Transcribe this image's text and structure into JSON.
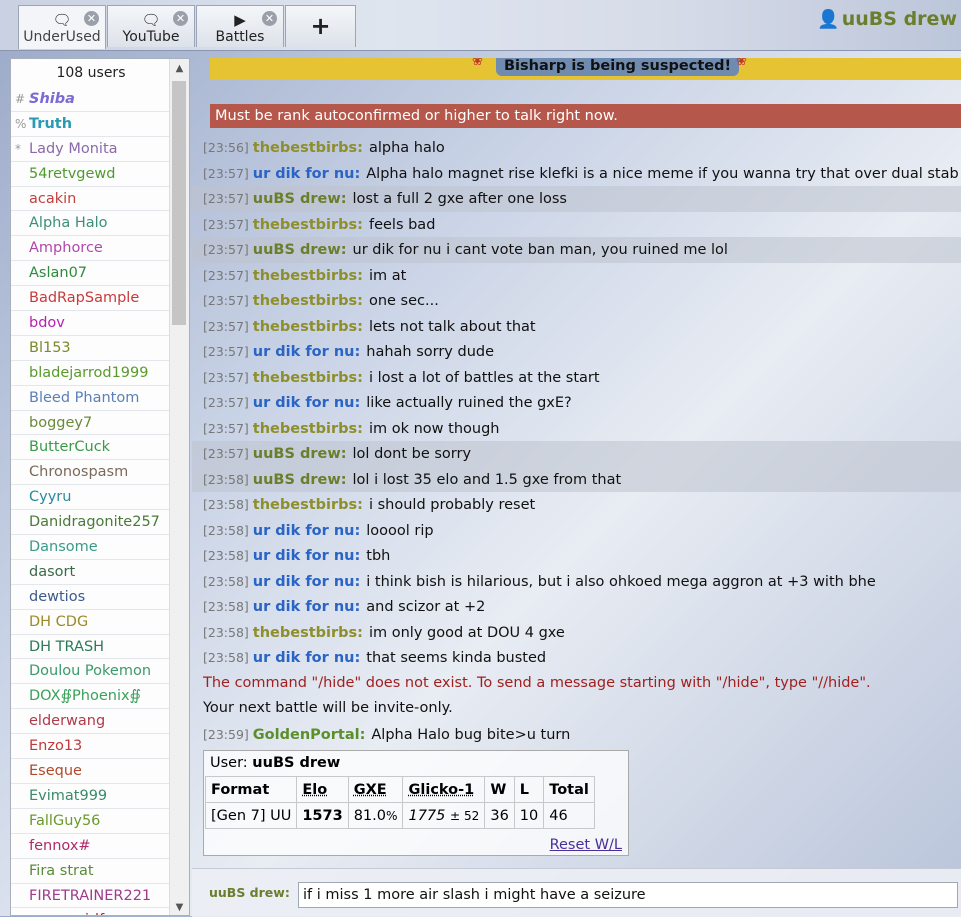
{
  "tabs": [
    {
      "label": "UnderUsed",
      "icon": "chat-bubble-icon",
      "active": true
    },
    {
      "label": "YouTube",
      "icon": "chat-bubble-icon",
      "active": false
    },
    {
      "label": "Battles",
      "icon": "battle-play-icon",
      "active": false
    }
  ],
  "new_tab_label": "+",
  "current_user": "uuBS drew",
  "userlist": {
    "count_label": "108 users",
    "users": [
      {
        "rank": "#",
        "name": "Shiba",
        "color": "#7b6bd4",
        "bold": true,
        "italic": true
      },
      {
        "rank": "%",
        "name": "Truth",
        "color": "#2a9bb0",
        "bold": true,
        "italic": false
      },
      {
        "rank": "*",
        "name": "Lady Monita",
        "color": "#8a6aa8",
        "bold": false,
        "italic": false
      },
      {
        "rank": "",
        "name": "54retvgewd",
        "color": "#4f9a2e",
        "bold": false,
        "italic": false
      },
      {
        "rank": "",
        "name": "acakin",
        "color": "#c2403e",
        "bold": false,
        "italic": false
      },
      {
        "rank": "",
        "name": "Alpha Halo",
        "color": "#3c8f7a",
        "bold": false,
        "italic": false
      },
      {
        "rank": "",
        "name": "Amphorce",
        "color": "#b048a8",
        "bold": false,
        "italic": false
      },
      {
        "rank": "",
        "name": "Aslan07",
        "color": "#2d8a3e",
        "bold": false,
        "italic": false
      },
      {
        "rank": "",
        "name": "BadRapSample",
        "color": "#c83a3a",
        "bold": false,
        "italic": false
      },
      {
        "rank": "",
        "name": "bdov",
        "color": "#b520b0",
        "bold": false,
        "italic": false
      },
      {
        "rank": "",
        "name": "Bl153",
        "color": "#7a8a2a",
        "bold": false,
        "italic": false
      },
      {
        "rank": "",
        "name": "bladejarrod1999",
        "color": "#5a9a2a",
        "bold": false,
        "italic": false
      },
      {
        "rank": "",
        "name": "Bleed Phantom",
        "color": "#5a80b8",
        "bold": false,
        "italic": false
      },
      {
        "rank": "",
        "name": "boggey7",
        "color": "#6a8a3a",
        "bold": false,
        "italic": false
      },
      {
        "rank": "",
        "name": "ButterCuck",
        "color": "#3a9a4a",
        "bold": false,
        "italic": false
      },
      {
        "rank": "",
        "name": "Chronospasm",
        "color": "#7a6a5a",
        "bold": false,
        "italic": false
      },
      {
        "rank": "",
        "name": "Cyyru",
        "color": "#2a8aa0",
        "bold": false,
        "italic": false
      },
      {
        "rank": "",
        "name": "Danidragonite257",
        "color": "#4a7a3a",
        "bold": false,
        "italic": false
      },
      {
        "rank": "",
        "name": "Dansome",
        "color": "#3a9a8a",
        "bold": false,
        "italic": false
      },
      {
        "rank": "",
        "name": "dasort",
        "color": "#3a6a4a",
        "bold": false,
        "italic": false
      },
      {
        "rank": "",
        "name": "dewtios",
        "color": "#3a5a8a",
        "bold": false,
        "italic": false
      },
      {
        "rank": "",
        "name": "DH CDG",
        "color": "#9a8a2a",
        "bold": false,
        "italic": false
      },
      {
        "rank": "",
        "name": "DH TRASH",
        "color": "#2a7a5a",
        "bold": false,
        "italic": false
      },
      {
        "rank": "",
        "name": "Doulou Pokemon",
        "color": "#3a9a6a",
        "bold": false,
        "italic": false
      },
      {
        "rank": "",
        "name": "DOX∯Phoenix∯",
        "color": "#3aa05a",
        "bold": false,
        "italic": false
      },
      {
        "rank": "",
        "name": "elderwang",
        "color": "#b03a4a",
        "bold": false,
        "italic": false
      },
      {
        "rank": "",
        "name": "Enzo13",
        "color": "#c03a3a",
        "bold": false,
        "italic": false
      },
      {
        "rank": "",
        "name": "Eseque",
        "color": "#b04a2a",
        "bold": false,
        "italic": false
      },
      {
        "rank": "",
        "name": "Evimat999",
        "color": "#3a8a6a",
        "bold": false,
        "italic": false
      },
      {
        "rank": "",
        "name": "FallGuy56",
        "color": "#6a9a2a",
        "bold": false,
        "italic": false
      },
      {
        "rank": "",
        "name": "fennox#",
        "color": "#b02a6a",
        "bold": false,
        "italic": false
      },
      {
        "rank": "",
        "name": "Fira strat",
        "color": "#5a8a3a",
        "bold": false,
        "italic": false
      },
      {
        "rank": "",
        "name": "FIRETRAINER221",
        "color": "#a03a8a",
        "bold": false,
        "italic": false
      },
      {
        "rank": "",
        "name": "gamergirlfun",
        "color": "#b02a2a",
        "bold": false,
        "italic": false
      }
    ]
  },
  "announcement": "Bisharp is being suspected!",
  "rank_warning": "Must be rank autoconfirmed or higher to talk right now.",
  "user_colors": {
    "thebestbirbs": "#8e8e2a",
    "urdik": "#2a64c4",
    "uubs": "#6b7e2c",
    "golden": "#5b8f2a"
  },
  "messages": [
    {
      "time": "[23:56]",
      "user": "thebestbirbs:",
      "key": "thebestbirbs",
      "text": "alpha halo",
      "hl": false
    },
    {
      "time": "[23:57]",
      "user": "ur dik for nu:",
      "key": "urdik",
      "text": "Alpha halo magnet rise klefki is a nice meme if you wanna try that over dual stab",
      "hl": false
    },
    {
      "time": "[23:57]",
      "user": "uuBS drew:",
      "key": "uubs",
      "text": "lost a full 2 gxe after one loss",
      "hl": true
    },
    {
      "time": "[23:57]",
      "user": "thebestbirbs:",
      "key": "thebestbirbs",
      "text": "feels bad",
      "hl": false
    },
    {
      "time": "[23:57]",
      "user": "uuBS drew:",
      "key": "uubs",
      "text": "ur dik for nu i cant vote ban man, you ruined me lol",
      "hl": true
    },
    {
      "time": "[23:57]",
      "user": "thebestbirbs:",
      "key": "thebestbirbs",
      "text": "im at",
      "hl": false
    },
    {
      "time": "[23:57]",
      "user": "thebestbirbs:",
      "key": "thebestbirbs",
      "text": "one sec...",
      "hl": false
    },
    {
      "time": "[23:57]",
      "user": "thebestbirbs:",
      "key": "thebestbirbs",
      "text": "lets not talk about that",
      "hl": false
    },
    {
      "time": "[23:57]",
      "user": "ur dik for nu:",
      "key": "urdik",
      "text": "hahah sorry dude",
      "hl": false
    },
    {
      "time": "[23:57]",
      "user": "thebestbirbs:",
      "key": "thebestbirbs",
      "text": "i lost a lot of battles at the start",
      "hl": false
    },
    {
      "time": "[23:57]",
      "user": "ur dik for nu:",
      "key": "urdik",
      "text": "like actually ruined the gxE?",
      "hl": false
    },
    {
      "time": "[23:57]",
      "user": "thebestbirbs:",
      "key": "thebestbirbs",
      "text": "im ok now though",
      "hl": false
    },
    {
      "time": "[23:57]",
      "user": "uuBS drew:",
      "key": "uubs",
      "text": "lol dont be sorry",
      "hl": true
    },
    {
      "time": "[23:58]",
      "user": "uuBS drew:",
      "key": "uubs",
      "text": "lol i lost 35 elo and 1.5 gxe from that",
      "hl": true
    },
    {
      "time": "[23:58]",
      "user": "thebestbirbs:",
      "key": "thebestbirbs",
      "text": "i should probably reset",
      "hl": false
    },
    {
      "time": "[23:58]",
      "user": "ur dik for nu:",
      "key": "urdik",
      "text": "looool rip",
      "hl": false
    },
    {
      "time": "[23:58]",
      "user": "ur dik for nu:",
      "key": "urdik",
      "text": "tbh",
      "hl": false
    },
    {
      "time": "[23:58]",
      "user": "ur dik for nu:",
      "key": "urdik",
      "text": "i think bish is hilarious, but i also ohkoed mega aggron at +3 with bhe",
      "hl": false
    },
    {
      "time": "[23:58]",
      "user": "ur dik for nu:",
      "key": "urdik",
      "text": "and scizor at +2",
      "hl": false
    },
    {
      "time": "[23:58]",
      "user": "thebestbirbs:",
      "key": "thebestbirbs",
      "text": "im only good at DOU 4 gxe",
      "hl": false
    },
    {
      "time": "[23:58]",
      "user": "ur dik for nu:",
      "key": "urdik",
      "text": "that seems kinda busted",
      "hl": false
    }
  ],
  "error_message": "The command \"/hide\" does not exist. To send a message starting with \"/hide\", type \"//hide\".",
  "notice_message": "Your next battle will be invite-only.",
  "last_message": {
    "time": "[23:59]",
    "user": "GoldenPortal:",
    "key": "golden",
    "text": "Alpha Halo bug bite>u turn"
  },
  "rank_box": {
    "user_label": "User:",
    "user_name": "uuBS drew",
    "headers": [
      "Format",
      "Elo",
      "GXE",
      "Glicko-1",
      "W",
      "L",
      "Total"
    ],
    "row": {
      "format": "[Gen 7] UU",
      "elo": "1573",
      "gxe": "81.0",
      "gxe_unit": "%",
      "glicko": "1775",
      "glicko_dev": "± 52",
      "w": "36",
      "l": "10",
      "total": "46"
    },
    "reset_label": "Reset W/L"
  },
  "input": {
    "prompt": "uuBS drew:",
    "value": "if i miss 1 more air slash i might have a seizure"
  }
}
